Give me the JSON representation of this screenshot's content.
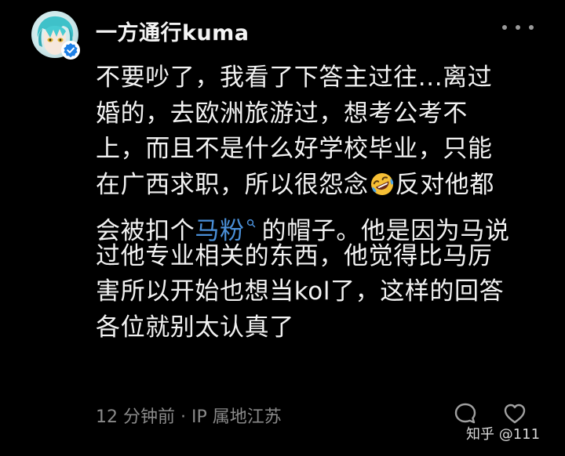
{
  "comment": {
    "username": "一方通行kuma",
    "verified": true,
    "lines": [
      {
        "text": "不要吵了，我看了下答主过往...离过"
      },
      {
        "text": "婚的，去欧洲旅游过，想考公考不"
      },
      {
        "text": "上，而且不是什么好学校毕业，只能"
      },
      {
        "before": "在广西求职，所以很怨念",
        "emoji": "rolling-on-floor-laughing-emoji",
        "after": "反对他都"
      },
      {
        "before": "会被扣个",
        "link": "马粉",
        "after": "的帽子。他是因为马说"
      },
      {
        "text": "过他专业相关的东西，他觉得比马厉"
      },
      {
        "text": "害所以开始也想当kol了，这样的回答"
      },
      {
        "text": "各位就别太认真了"
      }
    ],
    "meta": "12 分钟前 · IP 属地江苏"
  },
  "watermark": "知乎 @111",
  "colors": {
    "background": "#000000",
    "text": "#f2f2f2",
    "meta": "#8a8a8a",
    "link": "#4a8fd8",
    "verified_badge": "#1e80e6"
  }
}
